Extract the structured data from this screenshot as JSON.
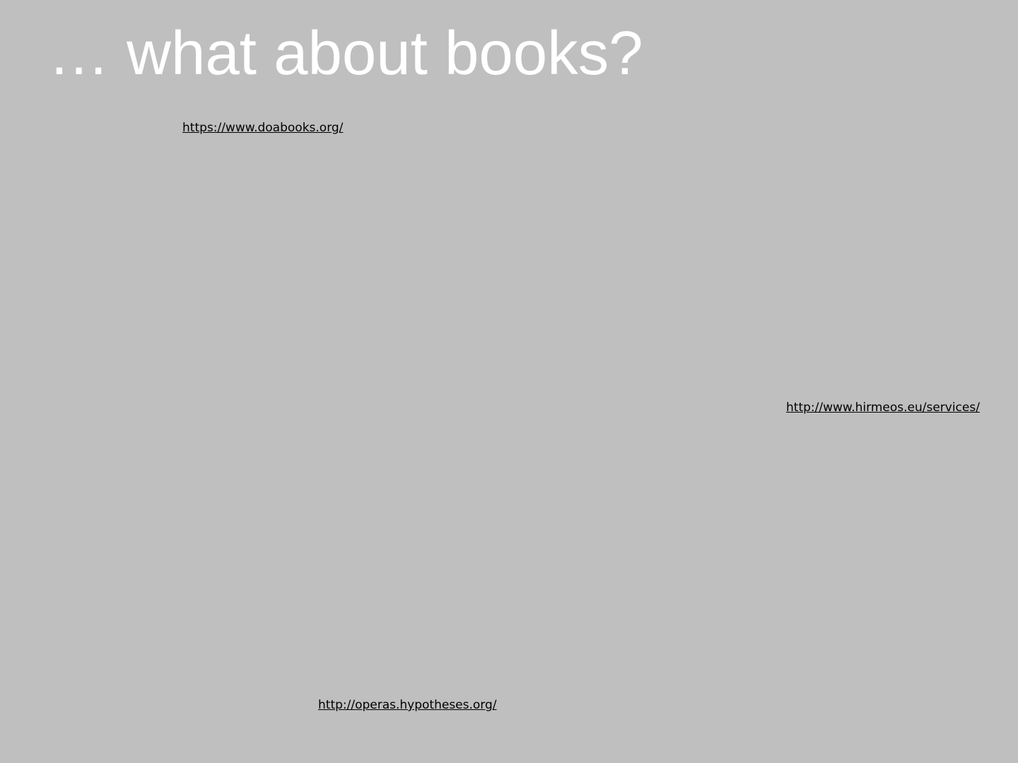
{
  "slide": {
    "title": "… what about books?",
    "links": {
      "doabooks": "https://www.doabooks.org/",
      "hirmeos": "http://www.hirmeos.eu/services/",
      "operas": "http://operas.hypotheses.org/"
    }
  },
  "colors": {
    "background": "#bfbfbf",
    "title_text": "#ffffff",
    "link_text": "#000000"
  }
}
